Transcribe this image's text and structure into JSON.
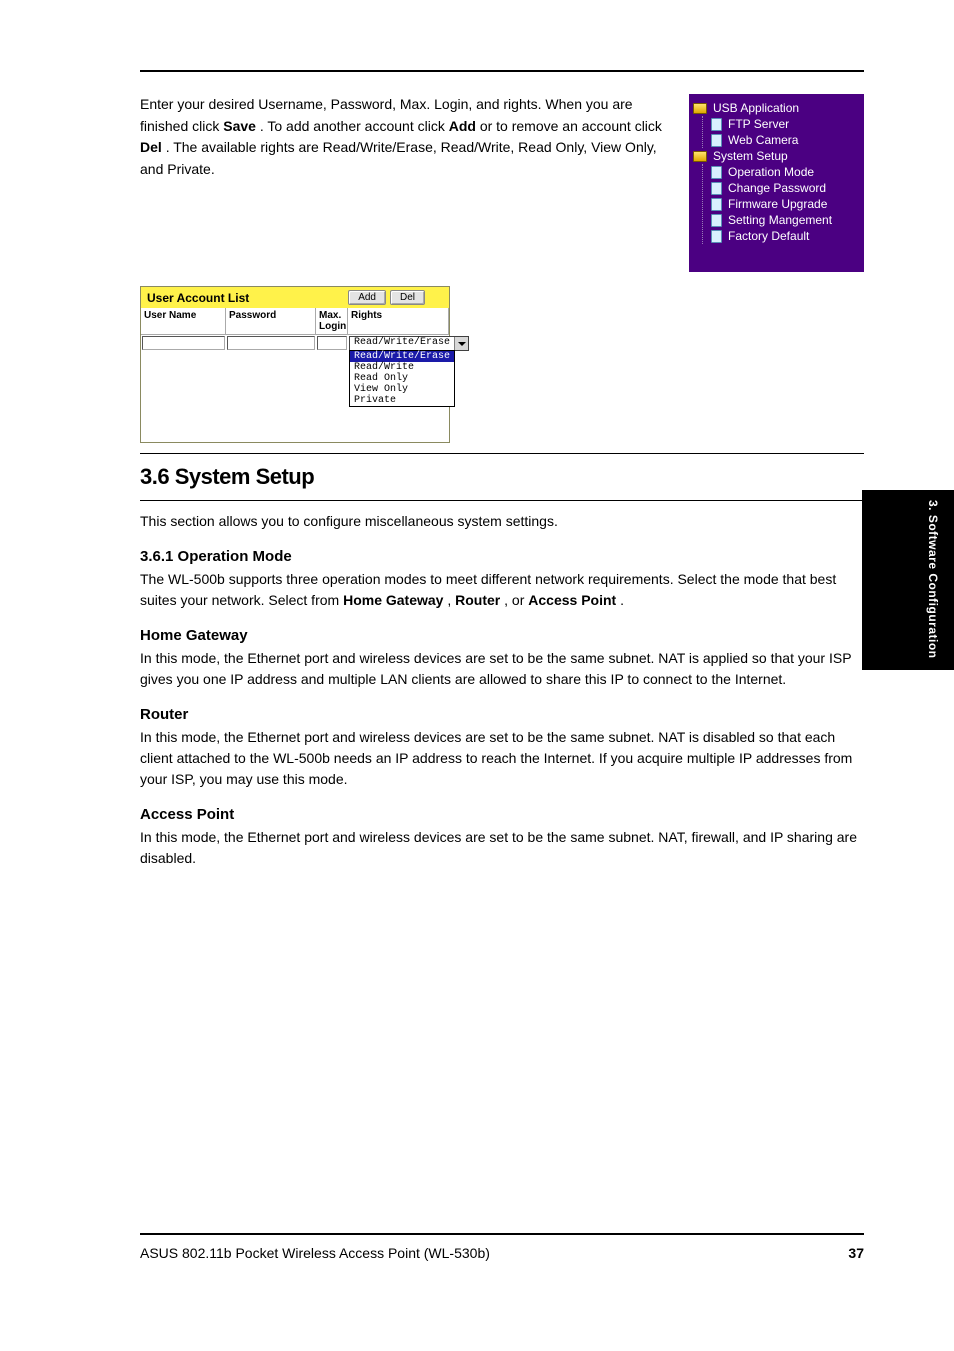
{
  "top_paragraph": {
    "part1": "Enter your desired Username, Password, Max. Login, and rights. When you are finished click ",
    "bold1": "Save",
    "part2": ". To add another account click ",
    "bold2": "Add",
    "part3": " or to remove an account click ",
    "bold3": "Del",
    "part4": ". The available rights are Read/Write/Erase, Read/Write, Read Only, View Only, and Private."
  },
  "nav": {
    "usb": {
      "label": "USB Application",
      "ftp": "FTP Server",
      "cam": "Web Camera"
    },
    "sys": {
      "label": "System Setup",
      "op": "Operation Mode",
      "pw": "Change Password",
      "fw": "Firmware Upgrade",
      "sm": "Setting Mangement",
      "fd": "Factory Default"
    }
  },
  "account_panel": {
    "title": "User Account List",
    "add": "Add",
    "del": "Del",
    "cols": {
      "user": "User Name",
      "pass": "Password",
      "max": "Max. Login",
      "rights": "Rights"
    },
    "dropdown": {
      "selected": "Read/Write/Erase",
      "options": [
        "Read/Write/Erase",
        "Read/Write",
        "Read Only",
        "View Only",
        "Private"
      ]
    }
  },
  "section": {
    "heading": "3.6 System Setup",
    "p1": "This section allows you to configure miscellaneous system settings.",
    "sub1": "3.6.1 Operation Mode",
    "p2_a": "The WL-500b supports three operation modes to meet different network requirements. Select the mode that best suites your network. Select from ",
    "p2_hg": "Home Gateway",
    "p2_b": ", ",
    "p2_rt": "Router",
    "p2_c": ", or ",
    "p2_ap": "Access Point",
    "p2_d": ".",
    "hg_title": "Home Gateway",
    "hg_text": "In this mode, the Ethernet port and wireless devices are set to be the same subnet. NAT is applied so that your ISP gives you one IP address and multiple LAN clients are allowed to share this IP to connect to the Internet.",
    "rt_title": "Router",
    "rt_text": "In this mode, the Ethernet port and wireless devices are set to be the same subnet. NAT is disabled so that each client attached to the WL-500b needs an IP address to reach the Internet. If you acquire multiple IP addresses from your ISP, you may use this mode.",
    "ap_title": "Access Point",
    "ap_text": "In this mode, the Ethernet port and wireless devices are set to be the same subnet. NAT, firewall, and IP sharing are disabled."
  },
  "side_tab": "3. Software Configuration",
  "footer": {
    "left": "ASUS 802.11b Pocket Wireless Access Point (WL-530b)",
    "right": "37"
  }
}
